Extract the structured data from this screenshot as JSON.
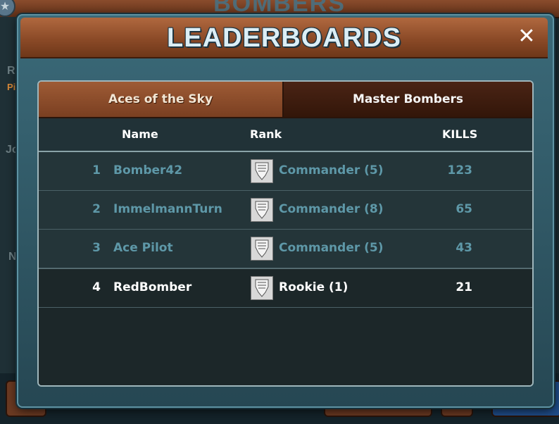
{
  "background": {
    "title": "BOMBERS",
    "side_letters": [
      "R",
      "Pi",
      "Jo",
      "N"
    ]
  },
  "modal": {
    "title": "LEADERBOARDS",
    "close_label": "✕"
  },
  "tabs": [
    {
      "label": "Aces of the Sky",
      "active": true
    },
    {
      "label": "Master Bombers",
      "active": false
    }
  ],
  "columns": {
    "name": "Name",
    "rank": "Rank",
    "kills": "KILLS"
  },
  "rows": [
    {
      "index": "1",
      "name": "Bomber42",
      "rank": "Commander (5)",
      "kills": "123",
      "highlight": false
    },
    {
      "index": "2",
      "name": "ImmelmannTurn",
      "rank": "Commander (8)",
      "kills": "65",
      "highlight": false
    },
    {
      "index": "3",
      "name": "Ace Pilot",
      "rank": "Commander (5)",
      "kills": "43",
      "highlight": false
    },
    {
      "index": "4",
      "name": "RedBomber",
      "rank": "Rookie (1)",
      "kills": "21",
      "highlight": true
    }
  ],
  "icons": {
    "rank": "rank-insignia-icon",
    "close": "close-icon",
    "star": "star-icon"
  },
  "colors": {
    "header_brown": "#8b4a27",
    "teal_text": "#5e98a8",
    "modal_teal": "#3b6a79"
  }
}
